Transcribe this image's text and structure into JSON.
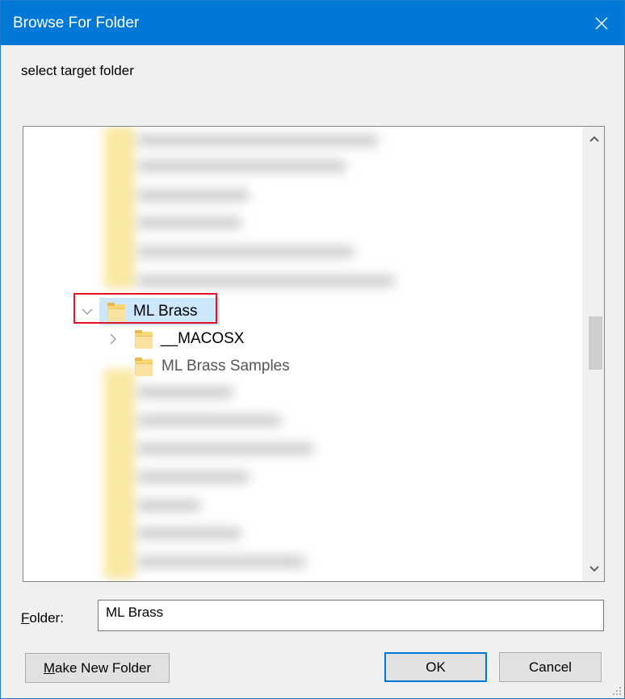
{
  "window": {
    "title": "Browse For Folder",
    "instruction": "select target folder"
  },
  "tree": {
    "selected_item": "ML Brass",
    "items": [
      {
        "label": "ML Brass",
        "expanded": true,
        "selected": true,
        "highlighted": true
      },
      {
        "label": "__MACOSX",
        "expanded": false,
        "has_children": true
      },
      {
        "label": "ML Brass Samples",
        "has_children": false
      }
    ]
  },
  "folder_field": {
    "label_prefix": "F",
    "label_rest": "older:",
    "value": "ML Brass"
  },
  "buttons": {
    "make_new_folder_prefix": "M",
    "make_new_folder_rest": "ake New Folder",
    "ok": "OK",
    "cancel": "Cancel"
  },
  "colors": {
    "title_bar": "#0078d7",
    "selection": "#cce8ff",
    "highlight_box": "#e81123",
    "folder": "#f8d775"
  }
}
